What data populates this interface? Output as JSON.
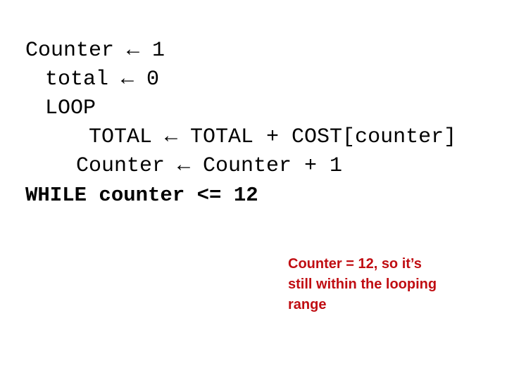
{
  "slide": {
    "background_color": "#ffffff",
    "text_color": "#000000"
  },
  "code": {
    "lines": [
      {
        "text": "Counter ← 1",
        "indent": 0,
        "bold": false
      },
      {
        "text": "total ← 0",
        "indent": 1,
        "bold": false
      },
      {
        "text": "LOOP",
        "indent": 1,
        "bold": false
      },
      {
        "text": "TOTAL ← TOTAL + COST[counter]",
        "indent": 2,
        "bold": false
      },
      {
        "text": "Counter ← Counter + 1",
        "indent": 3,
        "bold": false
      },
      {
        "text": "WHILE counter <= 12",
        "indent": 0,
        "bold": true
      }
    ]
  },
  "annotation": {
    "color": "#C00D12",
    "lines": [
      "Counter = 12, so it’s",
      "still within the looping",
      "range"
    ]
  }
}
